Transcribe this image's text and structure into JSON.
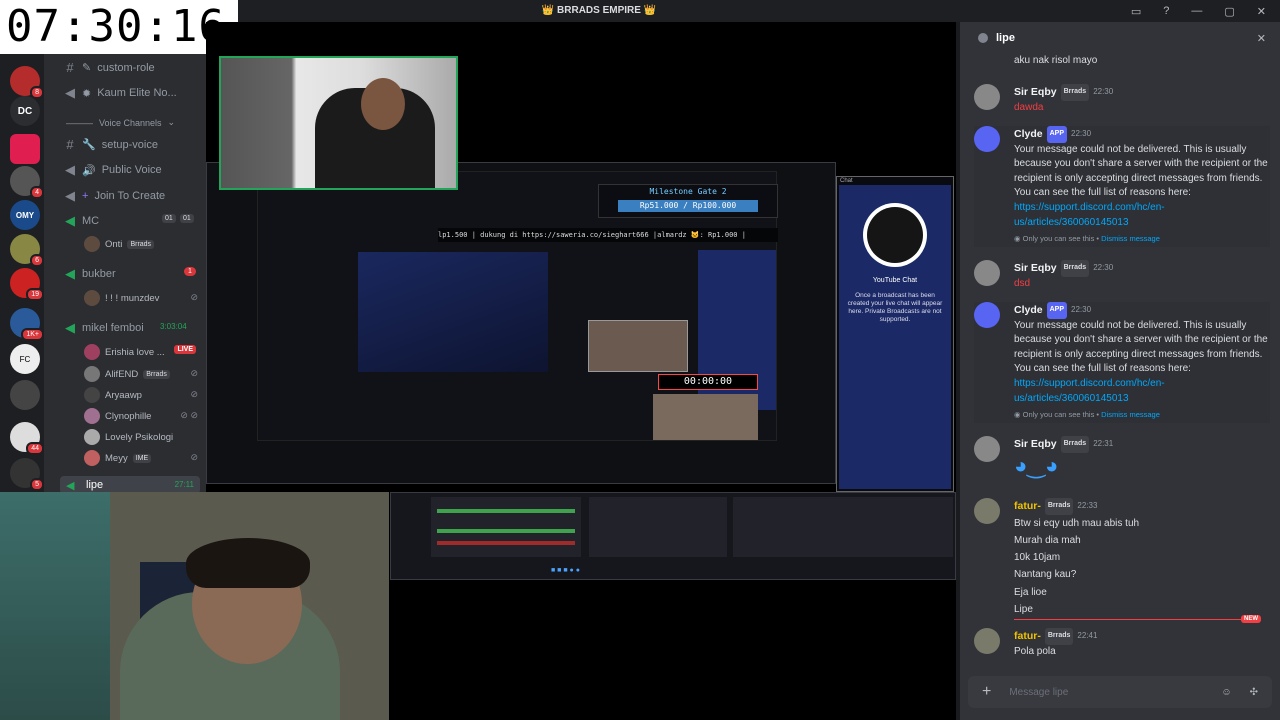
{
  "clock": "07:30:16",
  "window_title": "👑 BRRADS EMPIRE 👑",
  "servers": [
    {
      "badge": "8"
    },
    {
      "label": "DC"
    },
    {
      "badge": ""
    },
    {
      "badge": "4"
    },
    {
      "label": "OMY"
    },
    {
      "badge": "6"
    },
    {
      "badge": "19"
    },
    {
      "badge": "1K+"
    },
    {
      "label": "FC"
    },
    {
      "badge": ""
    },
    {
      "badge": "44"
    },
    {
      "badge": "5"
    }
  ],
  "channels": {
    "text1": "custom-role",
    "voice1": "Kaum Elite No...",
    "category": "Voice Channels",
    "text2": "setup-voice",
    "voice2": "Public Voice",
    "create": "Join To Create",
    "mc": {
      "name": "MC",
      "count_a": "01",
      "count_b": "01"
    },
    "mc_user": "Onti",
    "bukber": {
      "name": "bukber",
      "badge": "1"
    },
    "bukber_user": "! ! ! munzdev",
    "mikel": {
      "name": "mikel femboi",
      "time": "3:03:04"
    },
    "mikel_users": [
      "Erishia love ...",
      "AlifEND",
      "Aryaawp",
      "Clynophille",
      "Lovely Psikologi",
      "Meyy"
    ],
    "live": "LIVE",
    "lipe": {
      "name": "lipe",
      "time": "27:11"
    }
  },
  "tags": {
    "brrads": "Brrads",
    "ime": "IME"
  },
  "dm": {
    "title": "lipe",
    "composer_placeholder": "Message lipe",
    "messages": [
      {
        "text": "aku nak risol mayo"
      },
      {
        "author": "Sir Eqby",
        "time": "22:30",
        "text": "dawda"
      },
      {
        "author": "Clyde",
        "app": "APP",
        "time": "22:30",
        "text": "Your message could not be delivered. This is usually because you don't share a server with the recipient or the recipient is only accepting direct messages from friends. You can see the full list of reasons here: ",
        "link": "https://support.discord.com/hc/en-us/articles/360060145013",
        "note": "Only you can see this • ",
        "dismiss": "Dismiss message"
      },
      {
        "author": "Sir Eqby",
        "time": "22:30",
        "text": "dsd"
      },
      {
        "author": "Clyde",
        "app": "APP",
        "time": "22:30",
        "text": "Your message could not be delivered. This is usually because you don't share a server with the recipient or the recipient is only accepting direct messages from friends. You can see the full list of reasons here: ",
        "link": "https://support.discord.com/hc/en-us/articles/360060145013",
        "note": "Only you can see this • ",
        "dismiss": "Dismiss message"
      },
      {
        "author": "Sir Eqby",
        "time": "22:31"
      },
      {
        "author": "fatur-",
        "time": "22:33",
        "lines": [
          "Btw si eqy udh mau abis tuh",
          "Murah dia mah",
          "10k 10jam",
          "Nantang kau?",
          "Eja lioe",
          "Lipe"
        ]
      },
      {
        "author": "fatur-",
        "time": "22:41",
        "text": "Pola pola"
      }
    ],
    "new_label": "NEW"
  },
  "stream": {
    "milestone": "Milestone Gate 2",
    "milestone_amount": "Rp51.000 / Rp100.000",
    "ticker": "lp1.500 | dukung di https://saweria.co/sieghart666 |almardz 🐱: Rp1.000 |",
    "timer": "00:00:00",
    "yt_title": "YouTube Chat",
    "yt_text": "Once a broadcast has been created your live chat will appear here. Private Broadcasts are not supported.",
    "chat_label": "Chat"
  },
  "colors": {
    "accent": "#5865f2",
    "online": "#23a559",
    "danger": "#f23f43"
  }
}
